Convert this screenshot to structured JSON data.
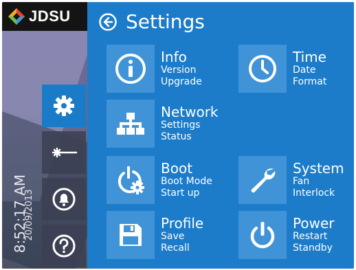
{
  "brand": {
    "name": "JDSU"
  },
  "status": {
    "time": "8:52:17 AM",
    "date": "20/09/2013"
  },
  "header": {
    "title": "Settings"
  },
  "nav": [
    {
      "icon": "gear-icon"
    },
    {
      "icon": "laser-icon"
    },
    {
      "icon": "bell-icon"
    },
    {
      "icon": "help-icon"
    }
  ],
  "tiles": {
    "info": {
      "title": "Info",
      "line1": "Version",
      "line2": "Upgrade",
      "icon": "info-icon"
    },
    "time": {
      "title": "Time",
      "line1": "Date",
      "line2": "Format",
      "icon": "clock-icon"
    },
    "network": {
      "title": "Network",
      "line1": "Settings",
      "line2": "Status",
      "icon": "network-icon"
    },
    "boot": {
      "title": "Boot",
      "line1": "Boot Mode",
      "line2": "Start up",
      "icon": "boot-icon"
    },
    "system": {
      "title": "System",
      "line1": "Fan",
      "line2": "Interlock",
      "icon": "wrench-icon"
    },
    "profile": {
      "title": "Profile",
      "line1": "Save",
      "line2": "Recall",
      "icon": "floppy-icon"
    },
    "power": {
      "title": "Power",
      "line1": "Restart",
      "line2": "Standby",
      "icon": "power-icon"
    }
  },
  "colors": {
    "panel": "#1c7cca",
    "tile": "#3f93d6",
    "active_nav": "#1a7cc8"
  }
}
